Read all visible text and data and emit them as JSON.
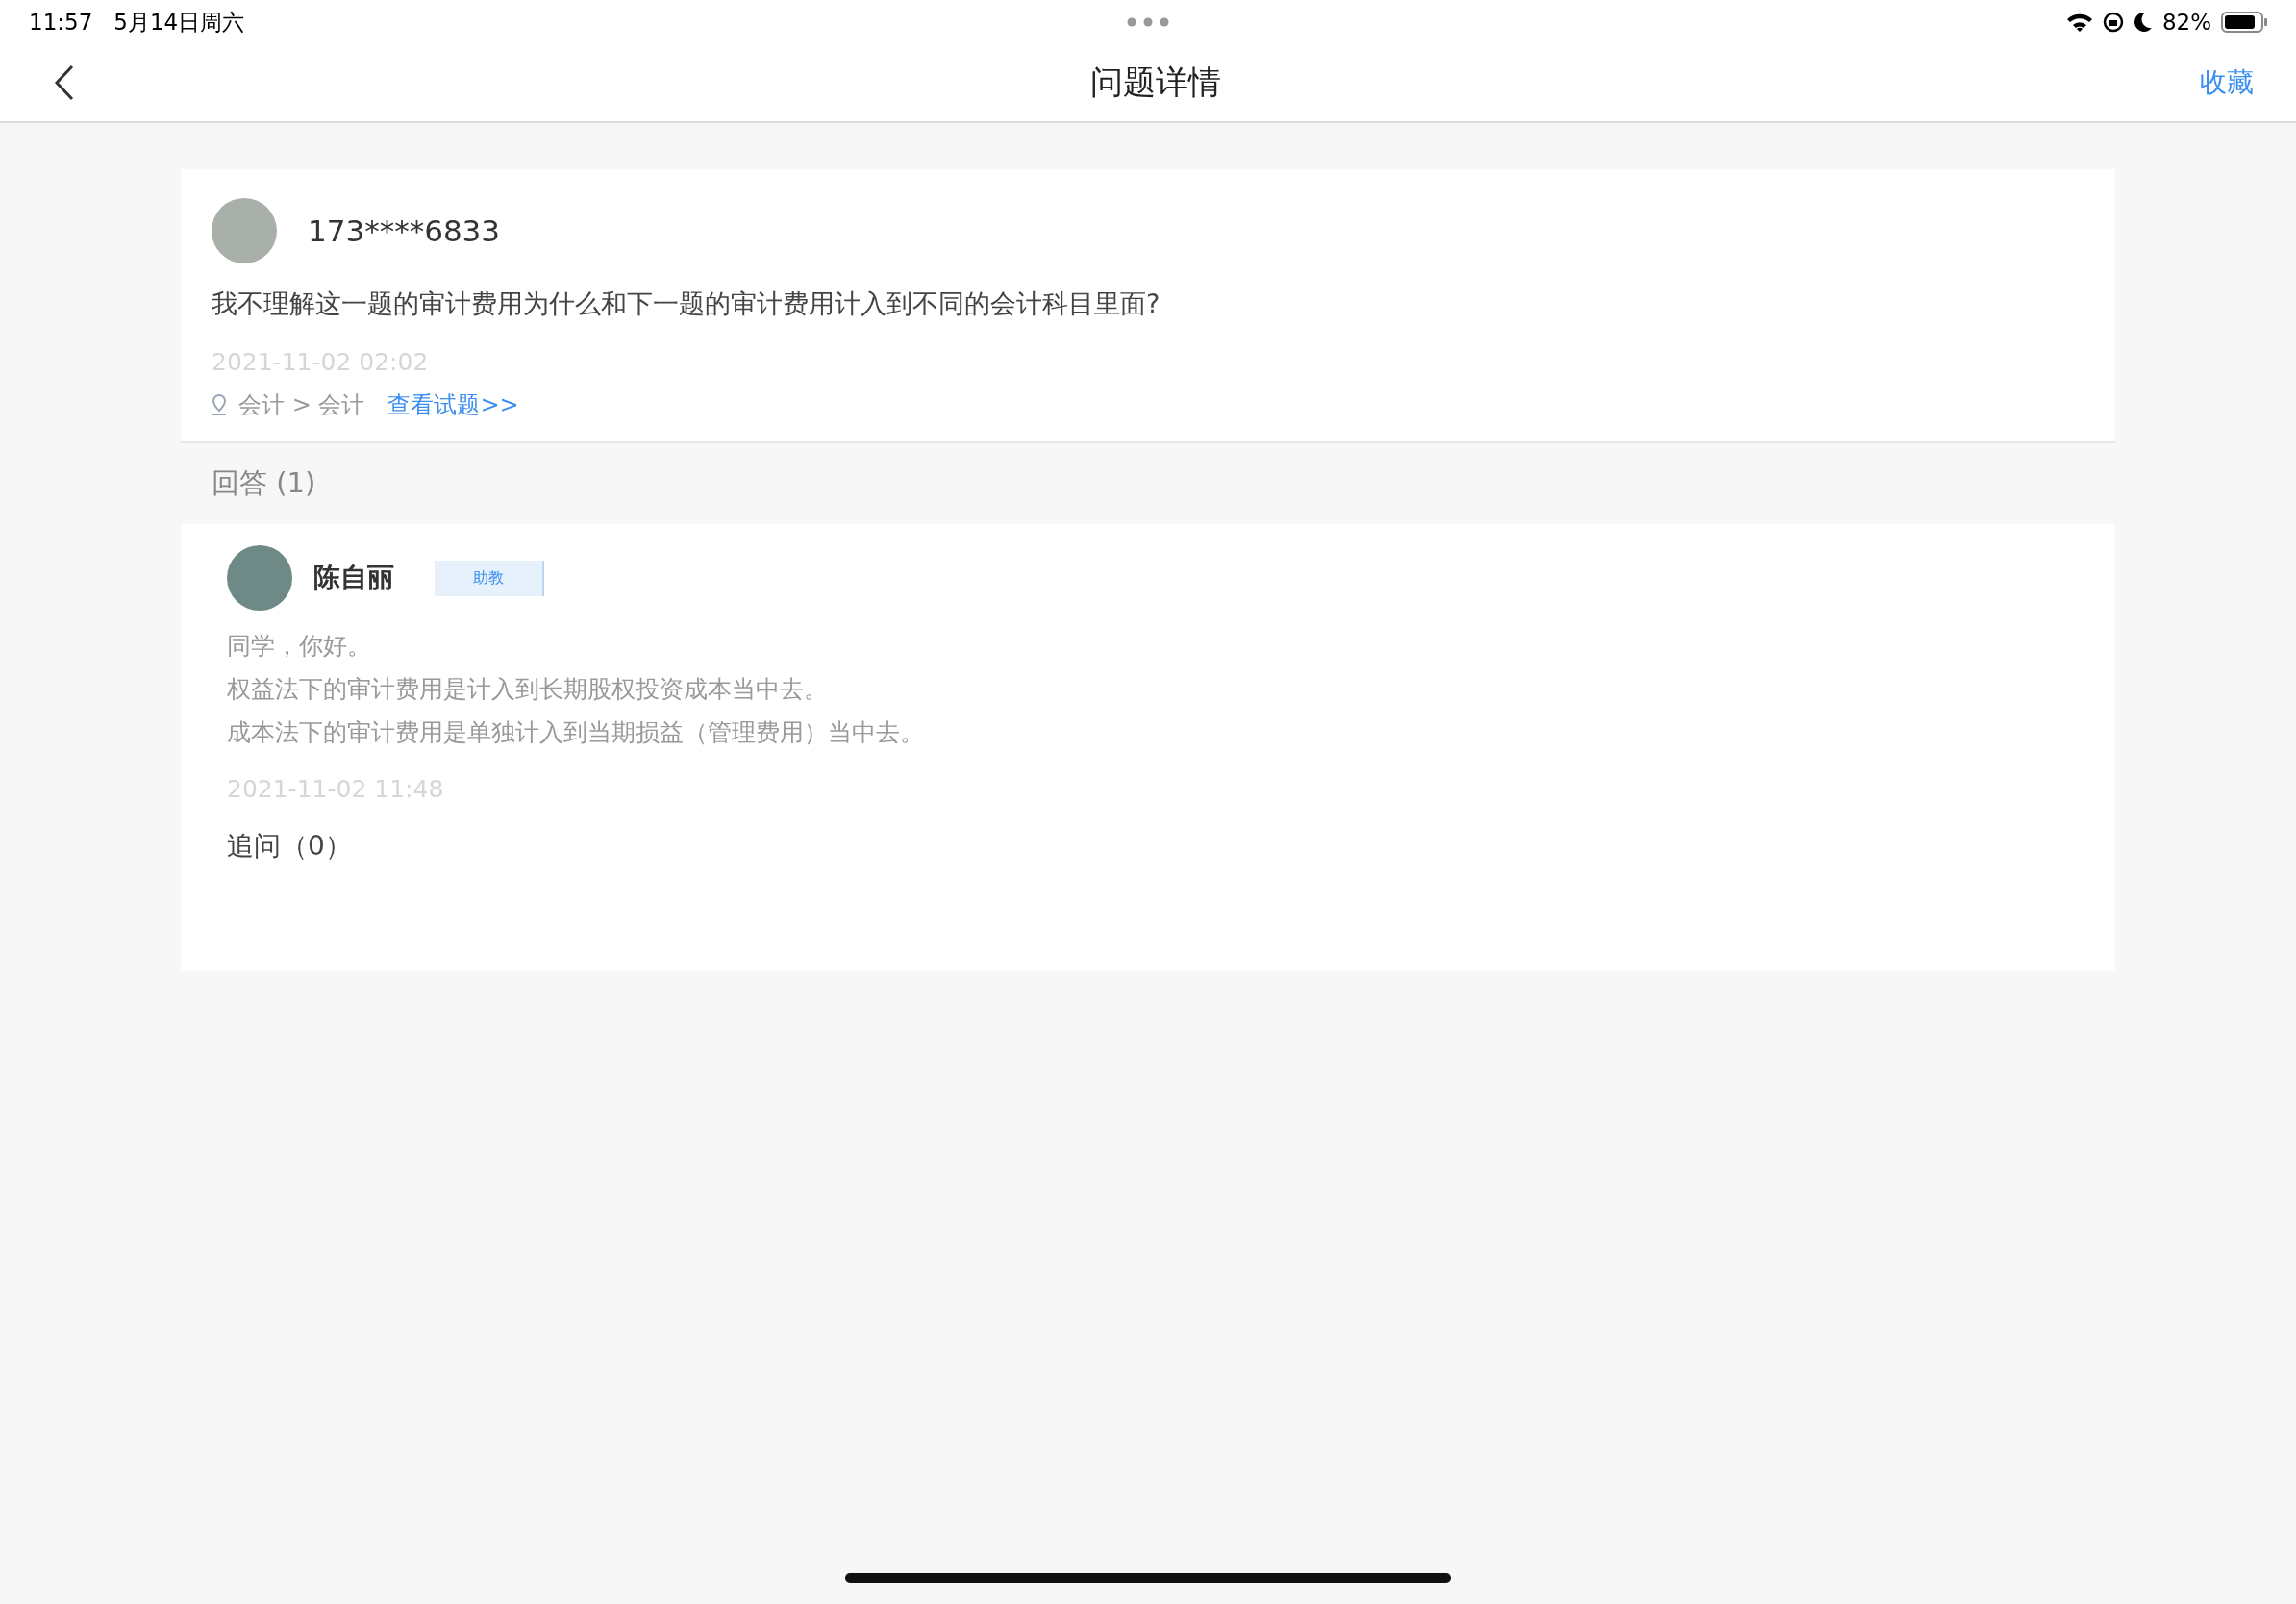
{
  "status_bar": {
    "time": "11:57",
    "date": "5月14日周六",
    "battery": "82%"
  },
  "nav": {
    "title": "问题详情",
    "action": "收藏"
  },
  "question": {
    "user": "173****6833",
    "text": "我不理解这一题的审计费用为什么和下一题的审计费用计入到不同的会计科目里面?",
    "time": "2021-11-02 02:02",
    "category": "会计 > 会计",
    "link": "查看试题>>"
  },
  "answers_header": "回答 (1)",
  "answers": [
    {
      "user": "陈自丽",
      "role": "助教",
      "lines": [
        "同学，你好。",
        "权益法下的审计费用是计入到长期股权投资成本当中去。",
        "成本法下的审计费用是单独计入到当期损益（管理费用）当中去。"
      ],
      "time": "2021-11-02 11:48",
      "follow_up": "追问（0）"
    }
  ]
}
